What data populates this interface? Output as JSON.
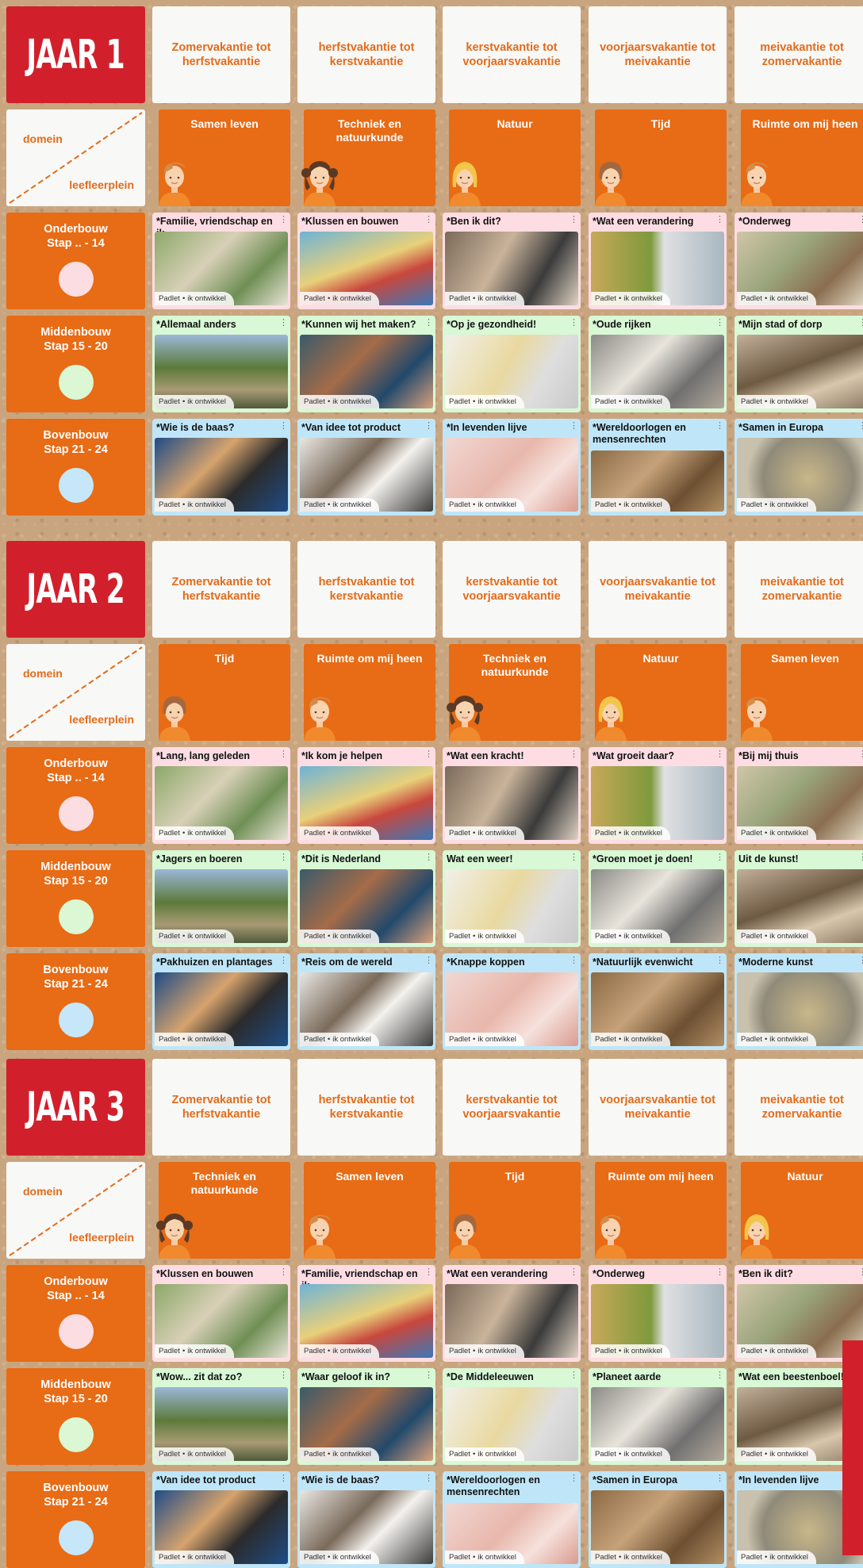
{
  "footer_text": {
    "left": "Padlet",
    "sep": "•",
    "right": "ik ontwikkel"
  },
  "domain_labels": {
    "domain": "domein",
    "leefleerplein": "leefleerplein"
  },
  "periods": [
    "Zomervakantie tot herfstvakantie",
    "herfstvakantie tot kerstvakantie",
    "kerstvakantie tot voorjaarsvakantie",
    "voorjaarsvakantie tot meivakantie",
    "meivakantie tot zomervakantie"
  ],
  "levels": [
    {
      "name": "Onderbouw",
      "stap": "Stap .. - 14",
      "dot_color": "#fcdde2"
    },
    {
      "name": "Middenbouw",
      "stap": "Stap 15 - 20",
      "dot_color": "#dbf7d3"
    },
    {
      "name": "Bovenbouw",
      "stap": "Stap 21 - 24",
      "dot_color": "#c6e6f9"
    }
  ],
  "years": [
    {
      "title": "JAAR 1",
      "topics": [
        "Samen leven",
        "Techniek en natuurkunde",
        "Natuur",
        "Tijd",
        "Ruimte om mij heen"
      ],
      "avatars": [
        "boy",
        "girl-dark",
        "girl-blonde",
        "girl-brown",
        "boy"
      ],
      "rows": [
        [
          "*Familie, vriendschap en ik",
          "*Klussen en bouwen",
          "*Ben ik dit?",
          "*Wat een verandering",
          "*Onderweg"
        ],
        [
          "*Allemaal anders",
          "*Kunnen wij het maken?",
          "*Op je gezondheid!",
          "*Oude rijken",
          "*Mijn stad of dorp"
        ],
        [
          "*Wie is de baas?",
          "*Van idee tot product",
          "*In levenden lijve",
          "*Wereldoorlogen en mensenrechten",
          "*Samen in Europa"
        ]
      ]
    },
    {
      "title": "JAAR 2",
      "topics": [
        "Tijd",
        "Ruimte om mij heen",
        "Techniek en natuurkunde",
        "Natuur",
        "Samen leven"
      ],
      "avatars": [
        "girl-brown",
        "boy",
        "girl-dark",
        "girl-blonde",
        "boy"
      ],
      "rows": [
        [
          "*Lang, lang geleden",
          "*Ik kom je helpen",
          "*Wat een kracht!",
          "*Wat groeit daar?",
          "*Bij mij thuis"
        ],
        [
          "*Jagers en boeren",
          "*Dit is Nederland",
          "Wat een weer!",
          "*Groen moet je doen!",
          "Uit de kunst!"
        ],
        [
          "*Pakhuizen en plantages",
          "*Reis om de wereld",
          "*Knappe koppen",
          "*Natuurlijk evenwicht",
          "*Moderne kunst"
        ]
      ]
    },
    {
      "title": "JAAR 3",
      "topics": [
        "Techniek en natuurkunde",
        "Samen leven",
        "Tijd",
        "Ruimte om mij heen",
        "Natuur"
      ],
      "avatars": [
        "girl-dark",
        "boy",
        "girl-brown",
        "boy",
        "girl-blonde"
      ],
      "rows": [
        [
          "*Klussen en bouwen",
          "*Familie, vriendschap en ik",
          "*Wat een verandering",
          "*Onderweg",
          "*Ben ik dit?"
        ],
        [
          "*Wow... zit dat zo?",
          "*Waar geloof ik in?",
          "*De Middeleeuwen",
          "*Planeet aarde",
          "*Wat een beestenboel!"
        ],
        [
          "*Van idee tot product",
          "*Wie is de baas?",
          "*Wereldoorlogen en mensenrechten",
          "*Samen in Europa",
          "*In levenden lijve"
        ]
      ]
    }
  ]
}
